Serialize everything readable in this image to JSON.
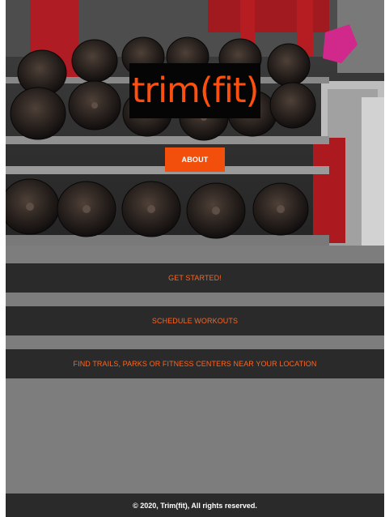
{
  "hero": {
    "logo": "trim(fit)",
    "about_label": "ABOUT"
  },
  "actions": [
    {
      "label": "GET STARTED!"
    },
    {
      "label": "SCHEDULE WORKOUTS"
    },
    {
      "label": "FIND TRAILS, PARKS OR FITNESS CENTERS NEAR YOUR LOCATION"
    }
  ],
  "footer": {
    "copyright": "© 2020, Trim(fit), All rights reserved."
  },
  "colors": {
    "accent": "#f24e0c",
    "bar_background": "#2a2a2a",
    "page_background": "#7d7d7d",
    "logo_background": "#050505"
  }
}
